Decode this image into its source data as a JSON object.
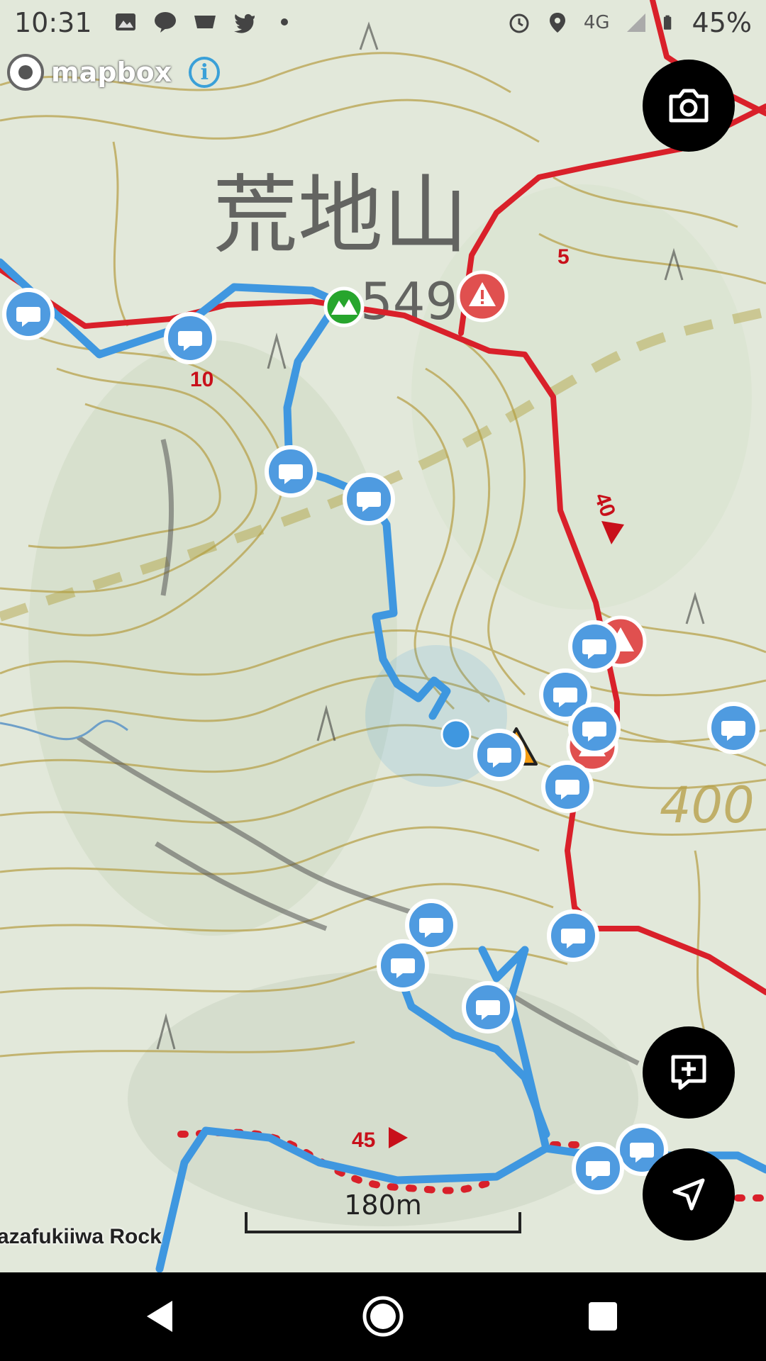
{
  "status_bar": {
    "time": "10:31",
    "network": "4G",
    "battery": "45%",
    "left_icons": [
      "image-icon",
      "line-icon",
      "wni-icon",
      "twitter-icon",
      "dot-icon"
    ],
    "right_icons": [
      "alarm-icon",
      "location-icon",
      "signal-icon",
      "battery-icon"
    ]
  },
  "map": {
    "attribution": "mapbox",
    "peak_name": "荒地山",
    "peak_elevation": "549",
    "contour_label": "400",
    "place_label": "azafukiiwa Rock",
    "scale_label": "180m",
    "distance_markers": [
      "5",
      "10",
      "40",
      "45"
    ],
    "colors": {
      "route_blue": "#3f97e0",
      "route_red": "#d9202a",
      "contour": "#b8a24c",
      "peak_green": "#27a52d",
      "warning_orange": "#f39c12",
      "hazard_red": "#e0504f"
    }
  },
  "buttons": {
    "camera": "camera-icon",
    "add_note": "add-note-icon",
    "navigate": "navigation-icon",
    "info": "i"
  },
  "nav_bar": {
    "back": "back-icon",
    "home": "home-icon",
    "recents": "recents-icon"
  }
}
